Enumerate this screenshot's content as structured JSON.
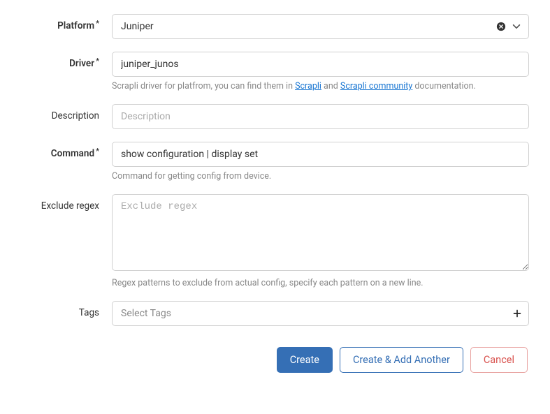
{
  "fields": {
    "platform": {
      "label": "Platform",
      "value": "Juniper"
    },
    "driver": {
      "label": "Driver",
      "value": "juniper_junos",
      "help_prefix": "Scrapli driver for platfrom, you can find them in ",
      "help_link1": "Scrapli",
      "help_mid": " and ",
      "help_link2": "Scrapli community",
      "help_suffix": " documentation."
    },
    "description": {
      "label": "Description",
      "value": "",
      "placeholder": "Description"
    },
    "command": {
      "label": "Command",
      "value": "show configuration | display set",
      "help": "Command for getting config from device."
    },
    "exclude_regex": {
      "label": "Exclude regex",
      "value": "",
      "placeholder": "Exclude regex",
      "help": "Regex patterns to exclude from actual config, specify each pattern on a new line."
    },
    "tags": {
      "label": "Tags",
      "placeholder": "Select Tags"
    }
  },
  "buttons": {
    "create": "Create",
    "create_add": "Create & Add Another",
    "cancel": "Cancel"
  }
}
